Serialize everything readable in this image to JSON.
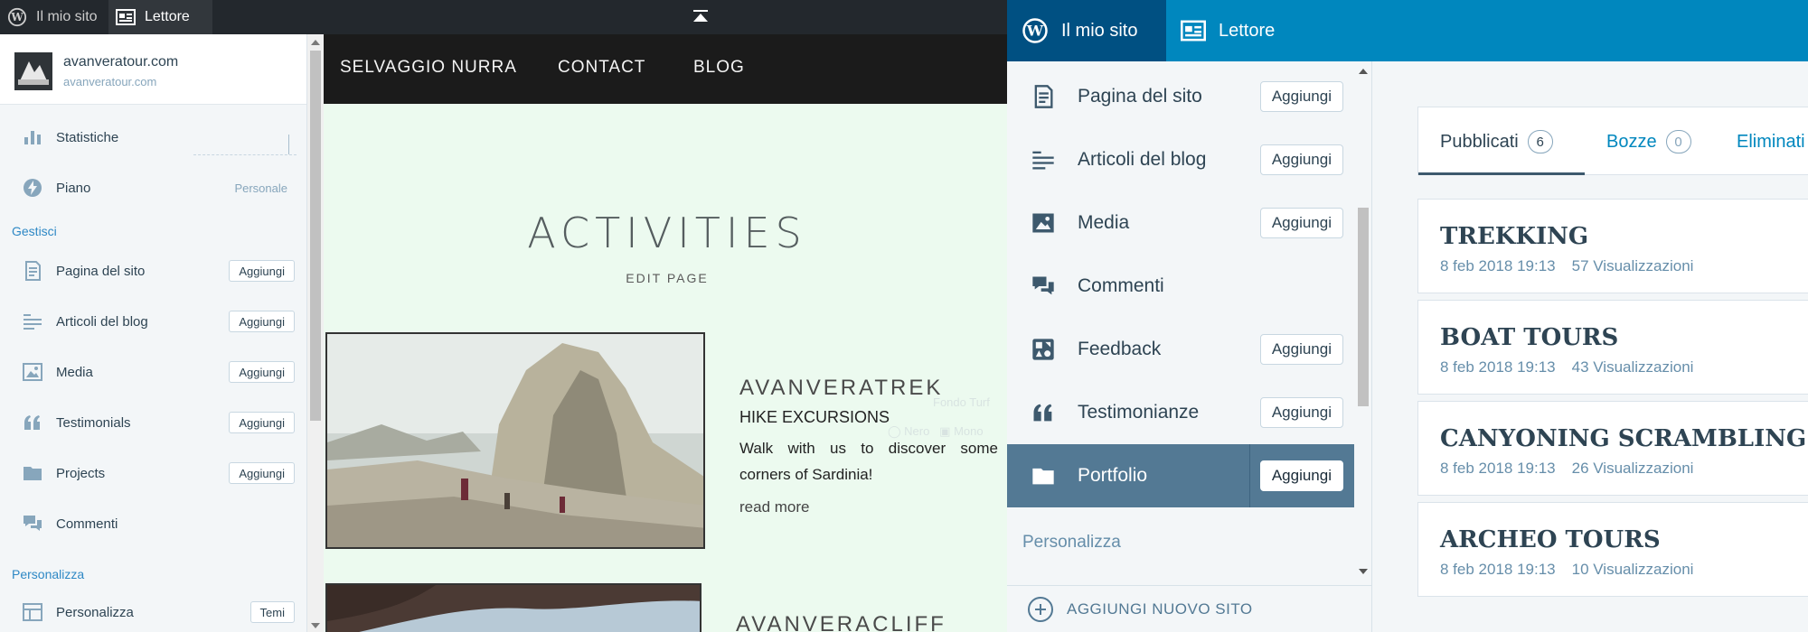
{
  "left_admin_bar": {
    "my_site": "Il mio sito",
    "reader": "Lettore"
  },
  "left_sidebar": {
    "site_name": "avanveratour.com",
    "site_url": "avanveratour.com",
    "stats": "Statistiche",
    "plan": "Piano",
    "plan_value": "Personale",
    "manage_header": "Gestisci",
    "items": [
      {
        "label": "Pagina del sito",
        "button": "Aggiungi"
      },
      {
        "label": "Articoli del blog",
        "button": "Aggiungi"
      },
      {
        "label": "Media",
        "button": "Aggiungi"
      },
      {
        "label": "Testimonials",
        "button": "Aggiungi"
      },
      {
        "label": "Projects",
        "button": "Aggiungi"
      },
      {
        "label": "Commenti",
        "button": ""
      }
    ],
    "personalize_header": "Personalizza",
    "personalize_item": "Personalizza",
    "themes_button": "Temi"
  },
  "preview": {
    "nav": [
      "SELVAGGIO NURRA",
      "CONTACT",
      "BLOG"
    ],
    "title": "ACTIVITIES",
    "edit_page": "EDIT PAGE",
    "card1": {
      "title": "AVANVERATREK",
      "subtitle": "HIKE EXCURSIONS",
      "description": "Walk with us to discover some corners of Sardinia!",
      "link": "read more"
    },
    "card2": {
      "title": "AVANVERACLIFF"
    }
  },
  "right_bar": {
    "my_site": "Il mio sito",
    "reader": "Lettore"
  },
  "right_sidebar": {
    "items": [
      {
        "label": "Pagina del sito",
        "button": "Aggiungi"
      },
      {
        "label": "Articoli del blog",
        "button": "Aggiungi"
      },
      {
        "label": "Media",
        "button": "Aggiungi"
      },
      {
        "label": "Commenti",
        "button": ""
      },
      {
        "label": "Feedback",
        "button": "Aggiungi"
      },
      {
        "label": "Testimonianze",
        "button": "Aggiungi"
      },
      {
        "label": "Portfolio",
        "button": "Aggiungi",
        "selected": true
      }
    ],
    "personalize_header": "Personalizza",
    "add_site": "AGGIUNGI NUOVO SITO"
  },
  "content": {
    "tabs": [
      {
        "label": "Pubblicati",
        "count": "6",
        "active": true
      },
      {
        "label": "Bozze",
        "count": "0"
      },
      {
        "label": "Eliminati"
      }
    ],
    "posts": [
      {
        "title": "TREKKING",
        "date": "8 feb 2018 19:13",
        "views": "57 Visualizzazioni"
      },
      {
        "title": "BOAT TOURS",
        "date": "8 feb 2018 19:13",
        "views": "43 Visualizzazioni"
      },
      {
        "title": "CANYONING SCRAMBLING",
        "date": "8 feb 2018 19:13",
        "views": "26 Visualizzazioni"
      },
      {
        "title": "ARCHEO TOURS",
        "date": "8 feb 2018 19:13",
        "views": "10 Visualizzazioni"
      }
    ]
  },
  "colors": {
    "wp_blue": "#0087be",
    "wp_dark_blue": "#005082",
    "selected_item": "#537994",
    "admin_bar": "#23282d",
    "text": "#2e4453"
  },
  "icons": [
    "wordpress-icon",
    "reader-icon",
    "stats-icon",
    "plan-icon",
    "page-icon",
    "posts-icon",
    "media-icon",
    "quote-icon",
    "folder-icon",
    "comments-icon",
    "feedback-icon",
    "customize-icon",
    "add-circle-icon",
    "collapse-arrow-icon"
  ]
}
